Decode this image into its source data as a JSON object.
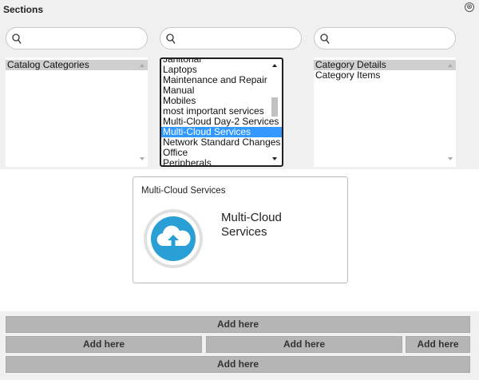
{
  "header": {
    "title": "Sections",
    "close_symbol": "⊗"
  },
  "searches": [
    {
      "placeholder": "",
      "value": ""
    },
    {
      "placeholder": "",
      "value": ""
    },
    {
      "placeholder": "",
      "value": ""
    }
  ],
  "lists": {
    "left": {
      "items": [
        "Catalog Categories"
      ],
      "selected": "Catalog Categories"
    },
    "middle": {
      "items": [
        "Janitorial",
        "Laptops",
        "Maintenance and Repair",
        "Manual",
        "Mobiles",
        "most important services",
        "Multi-Cloud Day-2 Services",
        "Multi-Cloud Services",
        "Network Standard Changes",
        "Office",
        "Peripherals"
      ],
      "selected": "Multi-Cloud Services"
    },
    "right": {
      "items": [
        "Category Details",
        "Category Items"
      ],
      "selected": "Category Details"
    }
  },
  "card": {
    "title": "Multi-Cloud Services",
    "name": "Multi-Cloud Services",
    "icon": "cloud-upload-icon",
    "icon_color": "#2a9fd6"
  },
  "add_rows": {
    "row1": "Add here",
    "row2": [
      "Add here",
      "Add here",
      "Add here"
    ],
    "row3": "Add here"
  },
  "colors": {
    "selection": "#3399ff",
    "bar": "#b5b5b5"
  }
}
